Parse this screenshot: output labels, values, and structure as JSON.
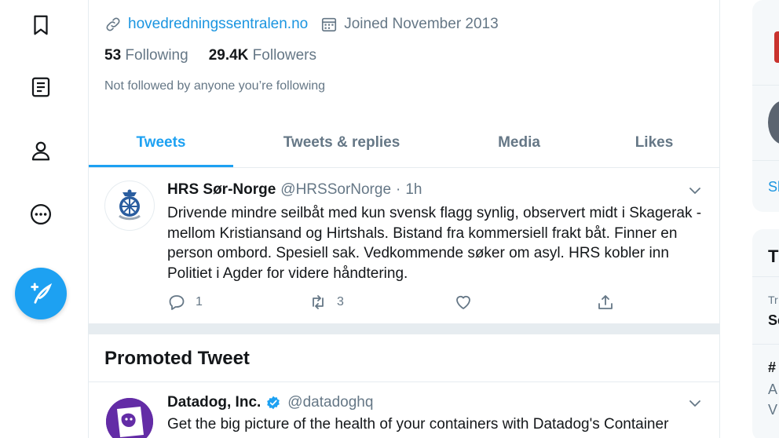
{
  "profile": {
    "website": "hovedredningssentralen.no",
    "joined": "Joined November 2013",
    "following_count": "53",
    "following_label": "Following",
    "followers_count": "29.4K",
    "followers_label": "Followers",
    "not_followed_text": "Not followed by anyone you’re following"
  },
  "tabs": [
    "Tweets",
    "Tweets & replies",
    "Media",
    "Likes"
  ],
  "active_tab": "Tweets",
  "tweet": {
    "name": "HRS Sør-Norge",
    "handle": "@HRSSorNorge",
    "separator": "·",
    "time": "1h",
    "text": "Drivende mindre seilbåt med kun svensk flagg synlig, observert midt i Skagerak - mellom Kristiansand og Hirtshals. Bistand fra kommersiell frakt båt. Finner en person ombord. Spesiell sak. Vedkommende søker om asyl. HRS kobler inn Politiet i Agder for videre håndtering.",
    "reply_count": "1",
    "retweet_count": "3",
    "like_count": "",
    "icons": [
      "reply-icon",
      "retweet-icon",
      "like-icon",
      "share-icon"
    ]
  },
  "promoted": {
    "title": "Promoted Tweet",
    "name": "Datadog, Inc.",
    "handle": "@datadoghq",
    "verified": true,
    "text": "Get the big picture of the health of your containers with Datadog's Container"
  },
  "right_column": {
    "partial_text_1": "Sh",
    "partial_text_2": "T",
    "partial_text_3": "Tr",
    "partial_text_4": "Se",
    "partial_text_5": "#",
    "partial_text_6": "A",
    "partial_text_7": "V"
  },
  "nav_icons": [
    "bookmark-icon",
    "lists-icon",
    "profile-icon",
    "more-icon",
    "compose-tweet-icon"
  ],
  "colors": {
    "accent": "#1da1f2",
    "text_secondary": "#657786",
    "link": "#1b95e0",
    "datadog_purple": "#632ca6"
  }
}
